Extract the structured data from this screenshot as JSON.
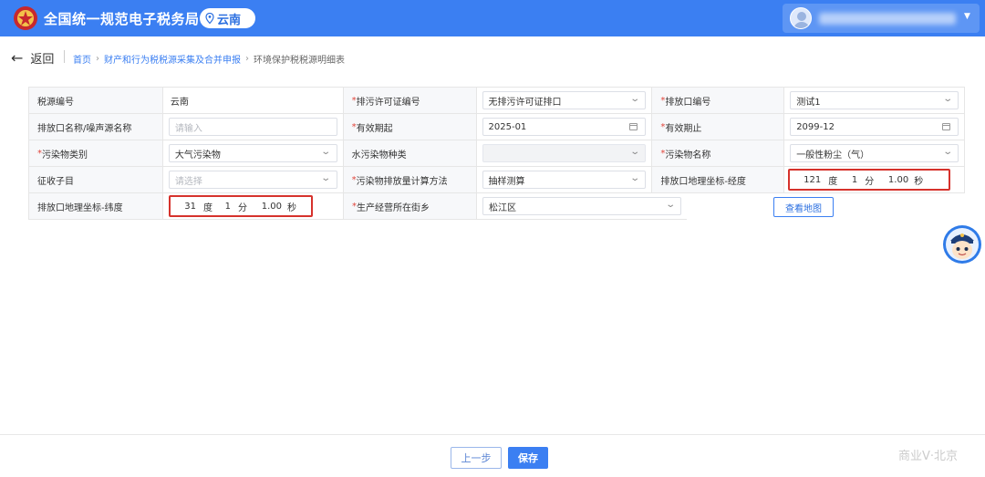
{
  "header": {
    "site_title": "全国统一规范电子税务局",
    "region": "云南",
    "user_name_hidden": ""
  },
  "nav": {
    "back_label": "返回",
    "breadcrumbs": [
      "首页",
      "财产和行为税税源采集及合并申报",
      "环境保护税税源明细表"
    ]
  },
  "form": {
    "r1": {
      "l1": "税源编号",
      "v1": "云南",
      "l2": "排污许可证编号",
      "v2": "无排污许可证排口",
      "l3": "排放口编号",
      "v3": "测试1"
    },
    "r2": {
      "l1": "排放口名称/噪声源名称",
      "v1_placeholder": "请输入",
      "l2": "有效期起",
      "v2": "2025-01",
      "l3": "有效期止",
      "v3": "2099-12"
    },
    "r3": {
      "l1": "污染物类别",
      "v1": "大气污染物",
      "l2": "水污染物种类",
      "v2": "",
      "l3": "污染物名称",
      "v3": "一般性粉尘（气）"
    },
    "r4": {
      "l1": "征收子目",
      "v1_placeholder": "请选择",
      "l2": "污染物排放量计算方法",
      "v2": "抽样测算",
      "l3": "排放口地理坐标-经度",
      "lng": {
        "deg": "121",
        "deg_unit": "度",
        "min": "1",
        "min_unit": "分",
        "sec": "1.00",
        "sec_unit": "秒"
      }
    },
    "r5": {
      "l1": "排放口地理坐标-纬度",
      "lat": {
        "deg": "31",
        "deg_unit": "度",
        "min": "1",
        "min_unit": "分",
        "sec": "1.00",
        "sec_unit": "秒"
      },
      "l2": "生产经营所在街乡",
      "v2": "松江区",
      "map_button": "查看地图"
    }
  },
  "footer": {
    "prev_label": "上一步",
    "save_label": "保存",
    "watermark": "商业V·北京"
  },
  "colors": {
    "primary": "#3b7ff2",
    "required": "#e0453b",
    "highlight_border": "#d6322c"
  },
  "icons": {
    "emblem": "tax-emblem-icon",
    "location": "location-pin-icon",
    "back": "arrow-left-icon",
    "dropdown": "chevron-down-icon",
    "calendar": "calendar-icon",
    "assistant": "assistant-robot-icon"
  }
}
